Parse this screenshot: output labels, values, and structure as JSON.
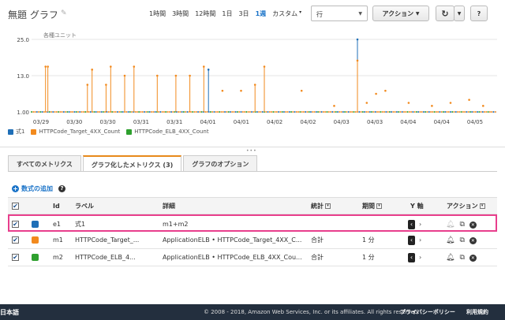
{
  "header": {
    "title": "無題 グラフ",
    "time_ranges": [
      "1時間",
      "3時間",
      "12時間",
      "1日",
      "3日",
      "1週",
      "カスタム"
    ],
    "active_range": "1週",
    "view_select": "行",
    "action_button": "アクション",
    "help_label": "?"
  },
  "chart_data": {
    "type": "scatter",
    "ylabel": "各種ユニット",
    "y_ticks": [
      "25.0",
      "13.0",
      "1.00"
    ],
    "x_ticks": [
      "03/29",
      "03/30",
      "03/30",
      "03/31",
      "03/31",
      "04/01",
      "04/01",
      "04/02",
      "04/02",
      "04/03",
      "04/03",
      "04/04",
      "04/04",
      "04/05"
    ],
    "ylim": [
      1,
      25
    ],
    "legend_position": "bottom-left",
    "series": [
      {
        "name": "式1",
        "color": "#1f6fb7"
      },
      {
        "name": "HTTPCode_Target_4XX_Count",
        "color": "#f28a1e"
      },
      {
        "name": "HTTPCode_ELB_4XX_Count",
        "color": "#2ea02e"
      }
    ],
    "spikes": [
      {
        "x": 0.03,
        "y": 16,
        "series": 1
      },
      {
        "x": 0.035,
        "y": 16,
        "series": 1
      },
      {
        "x": 0.12,
        "y": 10,
        "series": 1
      },
      {
        "x": 0.16,
        "y": 10,
        "series": 1
      },
      {
        "x": 0.13,
        "y": 15,
        "series": 1
      },
      {
        "x": 0.17,
        "y": 16,
        "series": 1
      },
      {
        "x": 0.2,
        "y": 13,
        "series": 1
      },
      {
        "x": 0.22,
        "y": 16,
        "series": 1
      },
      {
        "x": 0.27,
        "y": 13,
        "series": 1
      },
      {
        "x": 0.31,
        "y": 13,
        "series": 1
      },
      {
        "x": 0.34,
        "y": 13,
        "series": 1
      },
      {
        "x": 0.37,
        "y": 16,
        "series": 1
      },
      {
        "x": 0.38,
        "y": 15,
        "series": 0
      },
      {
        "x": 0.41,
        "y": 8,
        "series": 1
      },
      {
        "x": 0.45,
        "y": 8,
        "series": 1
      },
      {
        "x": 0.48,
        "y": 10,
        "series": 1
      },
      {
        "x": 0.5,
        "y": 16,
        "series": 1
      },
      {
        "x": 0.58,
        "y": 8,
        "series": 1
      },
      {
        "x": 0.65,
        "y": 3,
        "series": 1
      },
      {
        "x": 0.7,
        "y": 25,
        "series": 0
      },
      {
        "x": 0.7,
        "y": 18,
        "series": 1
      },
      {
        "x": 0.72,
        "y": 4,
        "series": 1
      },
      {
        "x": 0.74,
        "y": 7,
        "series": 1
      },
      {
        "x": 0.76,
        "y": 8,
        "series": 1
      },
      {
        "x": 0.81,
        "y": 4,
        "series": 1
      },
      {
        "x": 0.86,
        "y": 3,
        "series": 1
      },
      {
        "x": 0.9,
        "y": 4,
        "series": 1
      },
      {
        "x": 0.94,
        "y": 5,
        "series": 1
      },
      {
        "x": 0.97,
        "y": 3,
        "series": 1
      }
    ]
  },
  "tabs": [
    "すべてのメトリクス",
    "グラフ化したメトリクス (3)",
    "グラフのオプション"
  ],
  "add_expression": "数式の追加",
  "table": {
    "headers": {
      "id": "Id",
      "label": "ラベル",
      "details": "詳細",
      "stat": "統計",
      "period": "期間",
      "yaxis": "Y 軸",
      "actions": "アクション"
    },
    "rows": [
      {
        "color": "#1f6fb7",
        "id": "e1",
        "label": "式1",
        "details": "m1+m2",
        "stat": "",
        "period": ""
      },
      {
        "color": "#f28a1e",
        "id": "m1",
        "label": "HTTPCode_Target_...",
        "details": "ApplicationELB • HTTPCode_Target_4XX_C...",
        "stat": "合計",
        "period": "1 分"
      },
      {
        "color": "#2ea02e",
        "id": "m2",
        "label": "HTTPCode_ELB_4...",
        "details": "ApplicationELB • HTTPCode_ELB_4XX_Cou...",
        "stat": "合計",
        "period": "1 分"
      }
    ]
  },
  "footer": {
    "lang": "日本語",
    "copyright": "© 2008 - 2018, Amazon Web Services, Inc. or its affiliates. All rights reserved.",
    "privacy": "プライバシーポリシー",
    "terms": "利用規約"
  }
}
